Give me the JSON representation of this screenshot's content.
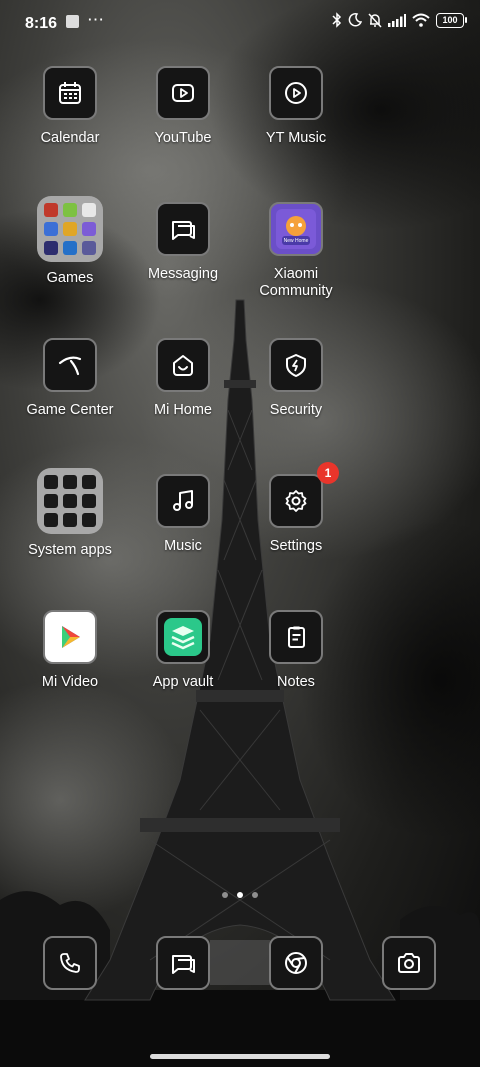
{
  "status_bar": {
    "time": "8:16",
    "more": "⋯",
    "battery": "100",
    "icons": [
      "bluetooth-icon",
      "moon-icon",
      "bell-off-icon",
      "signal-icon",
      "wifi-icon",
      "battery-icon"
    ]
  },
  "apps": {
    "calendar": "Calendar",
    "youtube": "YouTube",
    "yt_music": "YT Music",
    "games": "Games",
    "messaging": "Messaging",
    "xiaomi_community": "Xiaomi\nCommunity",
    "game_center": "Game Center",
    "mi_home": "Mi Home",
    "security": "Security",
    "system_apps": "System apps",
    "music": "Music",
    "settings": "Settings",
    "settings_badge": "1",
    "mi_video": "Mi Video",
    "app_vault": "App vault",
    "notes": "Notes"
  },
  "xiaomi_icon_text": "New Home",
  "dock": [
    "phone-icon",
    "messaging-icon",
    "chrome-icon",
    "camera-icon"
  ],
  "page_indicator": {
    "pages": 3,
    "active": 1
  },
  "colors": {
    "badge": "#e9352b",
    "icon_border": "#7a7a7a",
    "folder": "#a8a8a8"
  }
}
